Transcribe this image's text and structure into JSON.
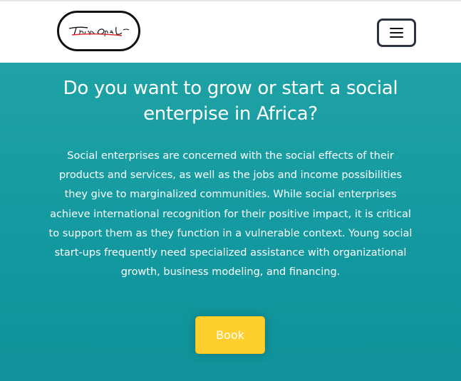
{
  "header": {
    "logo_text": "ThinkOpal",
    "menu_icon": "hamburger-icon"
  },
  "hero": {
    "title": "Do you want to grow or start a social enterpise in Africa?",
    "body": "Social enterprises are concerned with the social effects of their products and services, as well as the jobs and income possibilities they give to marginalized communities. While social enterprises achieve international recognition for their positive impact, it is critical to support them as they function in a vulnerable context. Young social start-ups frequently need specialized assistance with organizational growth, business modeling, and financing.",
    "button_label": "Book"
  },
  "colors": {
    "hero_top": "#1fa2a5",
    "hero_bottom": "#0f9299",
    "button": "#ffcf2e",
    "menu_border": "#2b3340",
    "logo_accent": "#d9262c"
  }
}
